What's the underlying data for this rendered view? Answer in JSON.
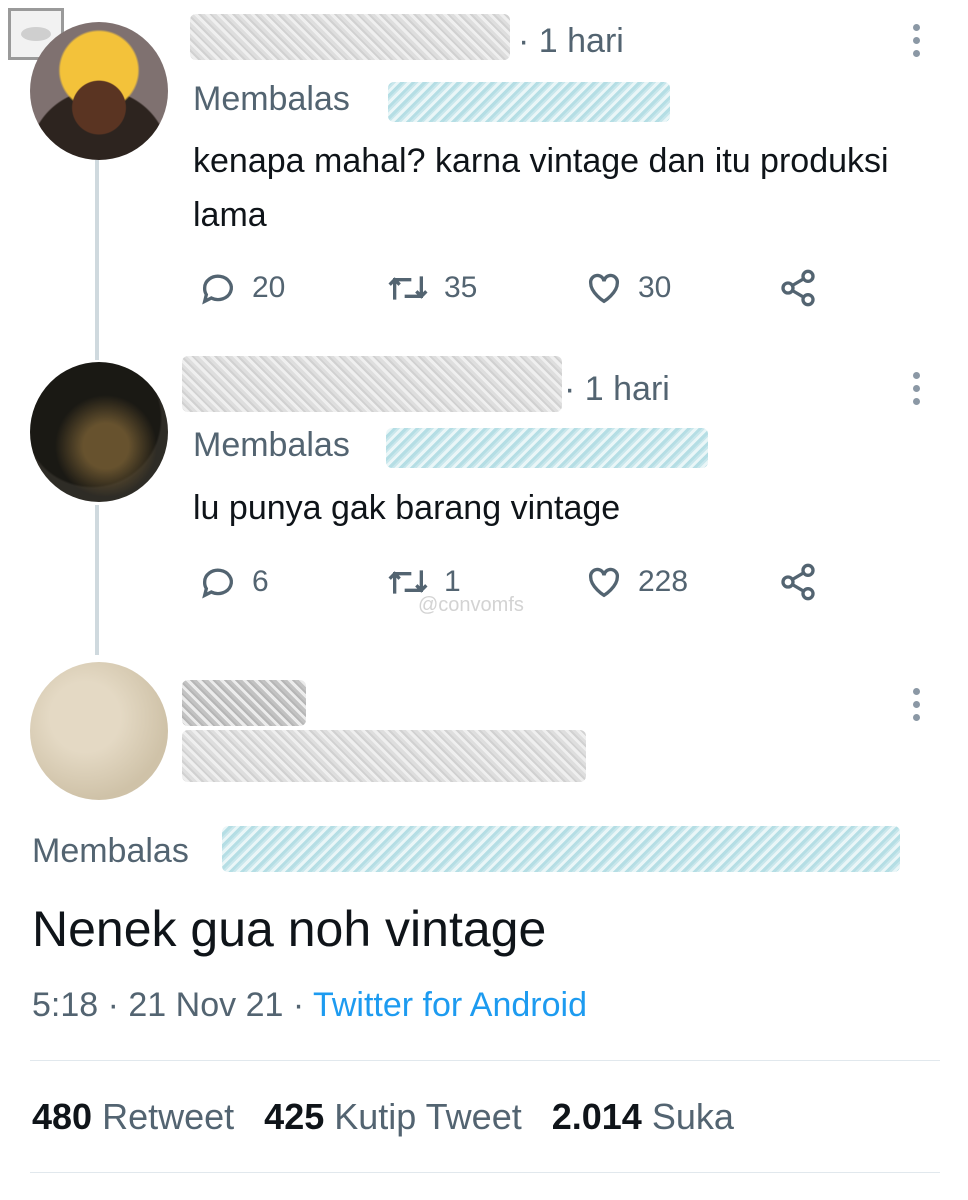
{
  "replies": [
    {
      "time": "· 1 hari",
      "membalas": "Membalas",
      "text": "kenapa mahal? karna vintage dan itu produksi lama",
      "replies": "20",
      "retweets": "35",
      "likes": "30"
    },
    {
      "time": "· 1 hari",
      "membalas": "Membalas",
      "text": "lu punya gak barang vintage",
      "replies": "6",
      "retweets": "1",
      "likes": "228"
    }
  ],
  "watermark": "@convomfs",
  "main_tweet": {
    "membalas": "Membalas",
    "text": "Nenek gua noh vintage",
    "timestamp": "5:18 · 21 Nov 21 · ",
    "source": "Twitter for Android"
  },
  "stats": {
    "retweet_count": "480",
    "retweet_label": "Retweet",
    "quote_count": "425",
    "quote_label": "Kutip Tweet",
    "like_count": "2.014",
    "like_label": "Suka"
  },
  "colors": {
    "secondary_text": "#536471",
    "link": "#1d9bf0",
    "thread_line": "#cfd9de"
  },
  "icons": [
    "reply-icon",
    "retweet-icon",
    "like-icon",
    "share-icon",
    "more-icon"
  ]
}
